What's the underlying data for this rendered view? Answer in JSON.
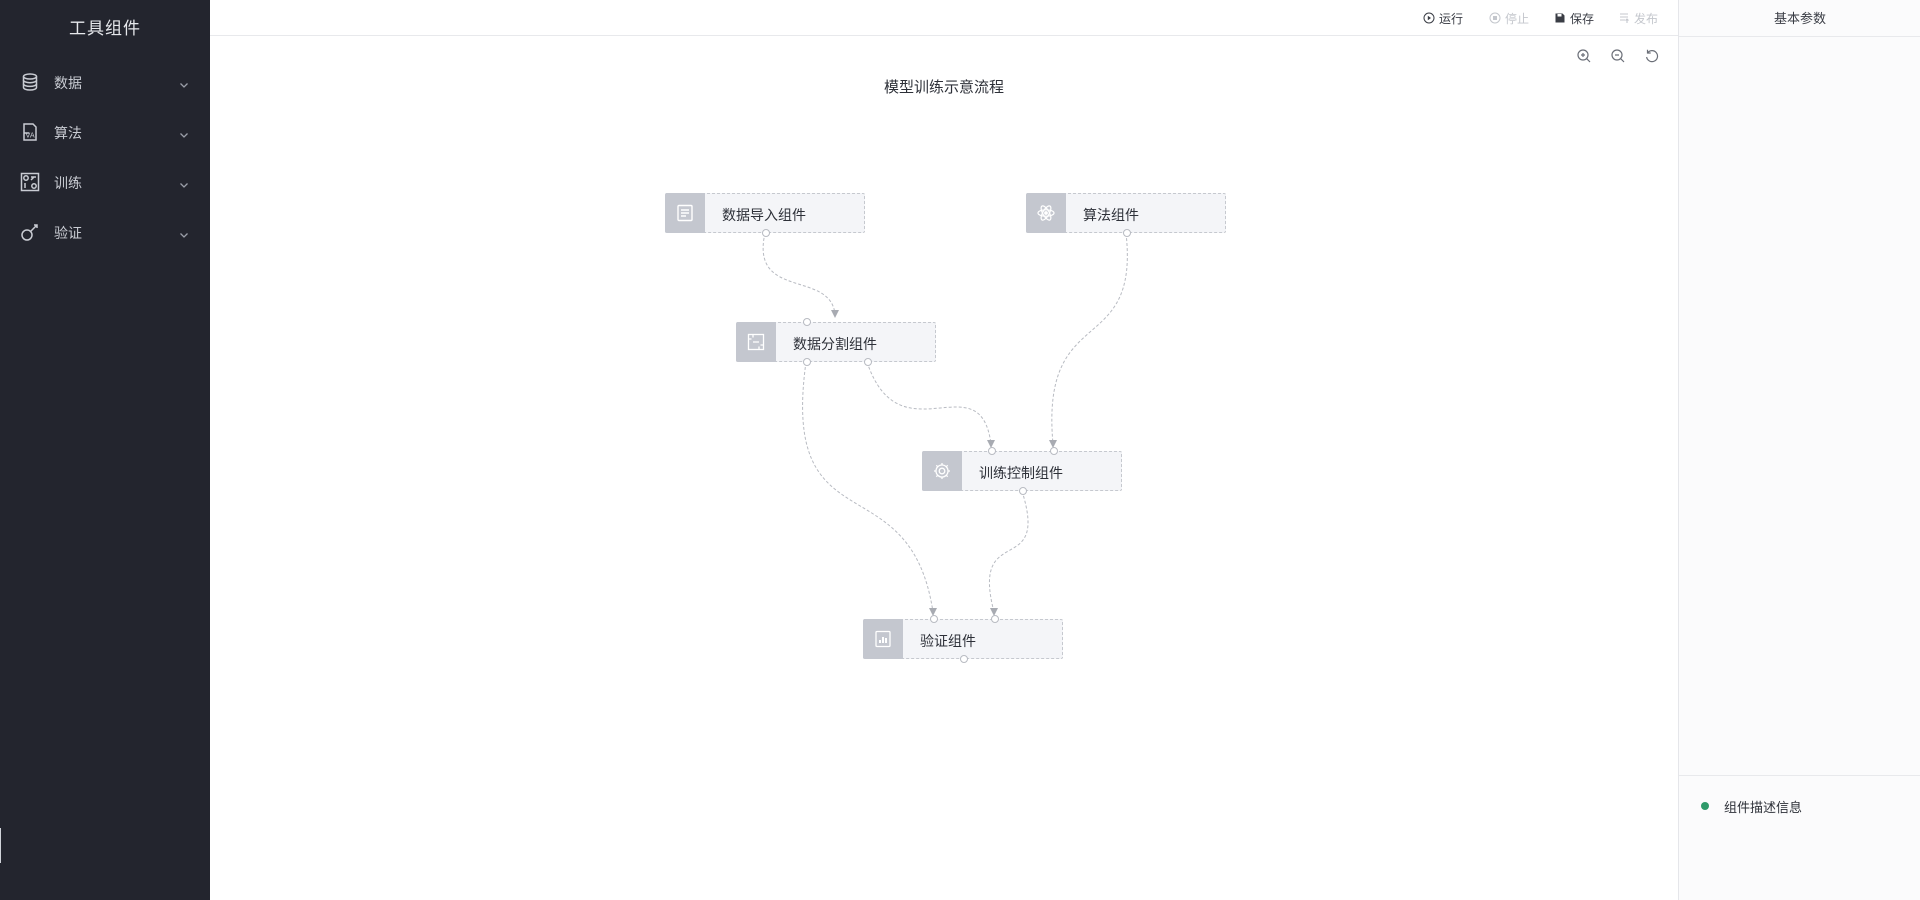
{
  "sidebar": {
    "title": "工具组件",
    "items": [
      {
        "label": "数据",
        "icon": "database-icon"
      },
      {
        "label": "算法",
        "icon": "algorithm-icon"
      },
      {
        "label": "训练",
        "icon": "training-icon"
      },
      {
        "label": "验证",
        "icon": "validation-icon"
      }
    ]
  },
  "toolbar": {
    "run_label": "运行",
    "stop_label": "停止",
    "save_label": "保存",
    "publish_label": "发布",
    "zoom_in_icon": "zoom-in-icon",
    "zoom_out_icon": "zoom-out-icon",
    "reset_icon": "reset-icon"
  },
  "flow": {
    "title": "模型训练示意流程",
    "nodes": [
      {
        "id": "import",
        "label": "数据导入组件",
        "icon": "document-icon"
      },
      {
        "id": "algo",
        "label": "算法组件",
        "icon": "atom-icon"
      },
      {
        "id": "split",
        "label": "数据分割组件",
        "icon": "split-icon"
      },
      {
        "id": "train",
        "label": "训练控制组件",
        "icon": "gear-icon"
      },
      {
        "id": "verify",
        "label": "验证组件",
        "icon": "report-icon"
      }
    ],
    "edges": [
      {
        "from": "import",
        "to": "split"
      },
      {
        "from": "algo",
        "to": "train"
      },
      {
        "from": "split",
        "to": "train"
      },
      {
        "from": "split",
        "to": "verify"
      },
      {
        "from": "train",
        "to": "verify"
      }
    ]
  },
  "right_panel": {
    "title": "基本参数",
    "description_label": "组件描述信息"
  },
  "colors": {
    "sidebar_bg": "#23252e",
    "node_bg": "#f4f5f8",
    "node_icon_bg": "#c4c7cf",
    "status_dot": "#2e9a6a"
  }
}
